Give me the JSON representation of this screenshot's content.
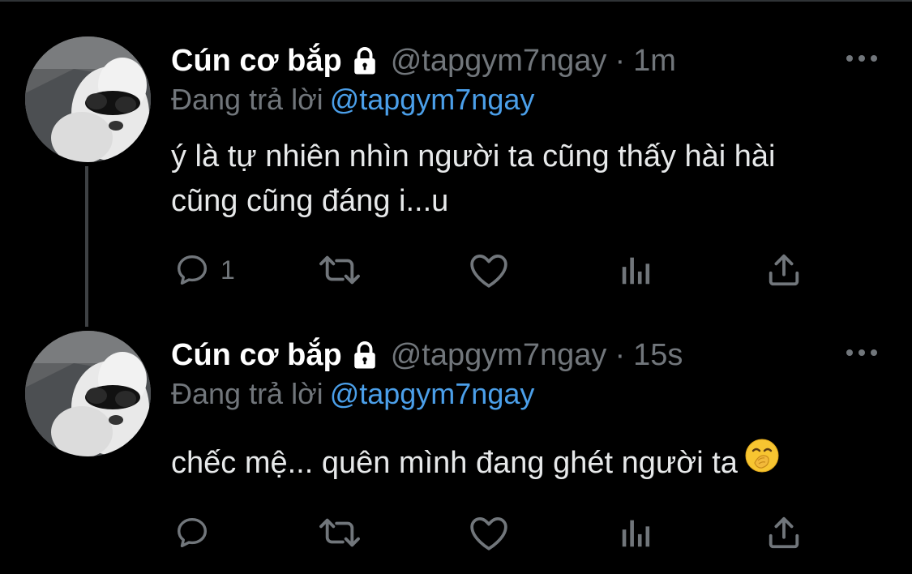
{
  "tweets": [
    {
      "author_name": "Cún cơ bắp",
      "handle": "@tapgym7ngay",
      "separator": "·",
      "time": "1m",
      "reply_label": "Đang trả lời",
      "reply_to": "@tapgym7ngay",
      "text_lines": [
        "ý là tự nhiên nhìn người ta cũng thấy hài hài",
        "cũng cũng đáng i...u"
      ],
      "reply_count": "1",
      "icons": [
        "lock-icon",
        "more-icon",
        "reply-icon",
        "retweet-icon",
        "like-icon",
        "analytics-icon",
        "share-icon"
      ]
    },
    {
      "author_name": "Cún cơ bắp",
      "handle": "@tapgym7ngay",
      "separator": "·",
      "time": "15s",
      "reply_label": "Đang trả lời",
      "reply_to": "@tapgym7ngay",
      "text_lines": [
        "chếc mệ... quên mình đang ghét người ta"
      ],
      "emoji": "face-with-hand-over-mouth",
      "reply_count": "",
      "icons": [
        "lock-icon",
        "more-icon",
        "reply-icon",
        "retweet-icon",
        "like-icon",
        "analytics-icon",
        "share-icon"
      ]
    }
  ],
  "colors": {
    "background": "#000000",
    "text": "#e7e9ea",
    "muted": "#71767b",
    "link": "#4b9fe9",
    "thread_line": "#3e4144"
  }
}
